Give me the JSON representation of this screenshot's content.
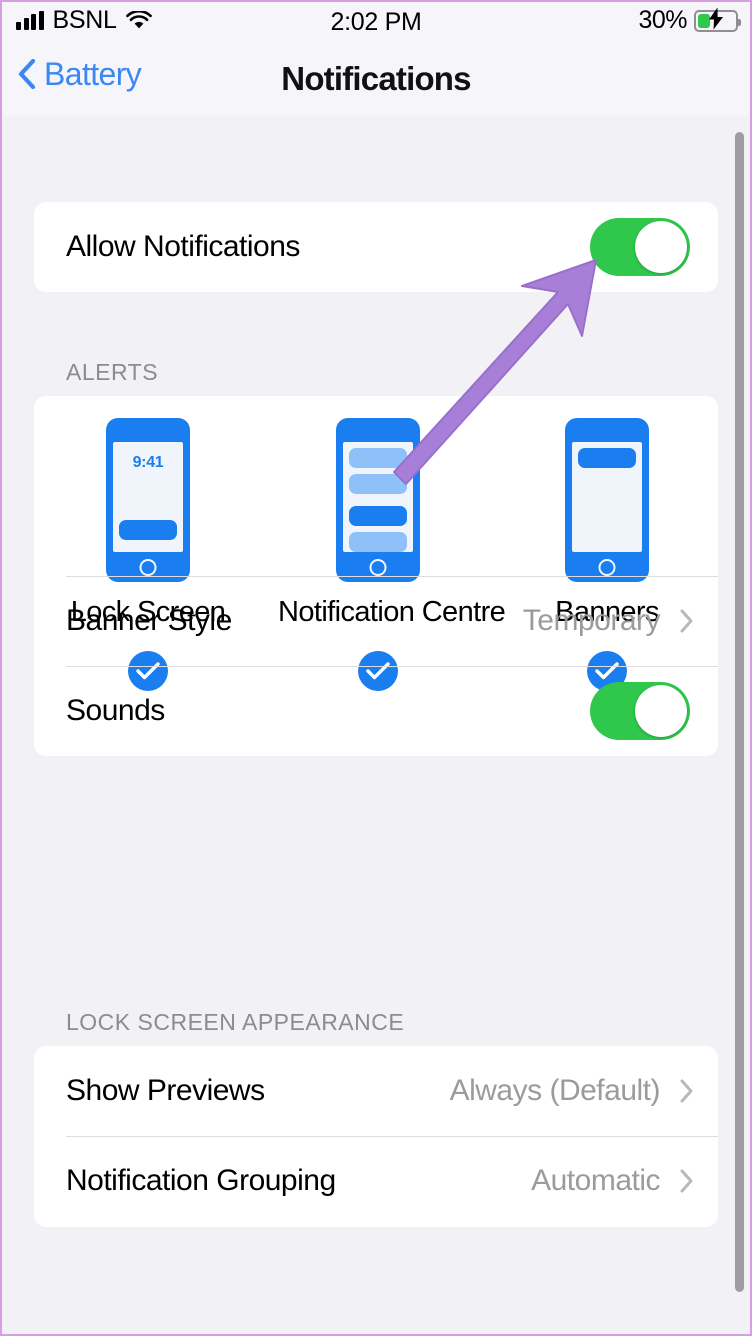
{
  "status_bar": {
    "carrier": "BSNL",
    "time": "2:02 PM",
    "battery_percent": "30%",
    "battery_level": 30,
    "charging": true,
    "signal_bars": 4,
    "wifi": true
  },
  "nav": {
    "back_label": "Battery",
    "title": "Notifications",
    "accent_color": "#3b87f5"
  },
  "main": {
    "allow": {
      "label": "Allow Notifications",
      "toggle_on": true
    },
    "alerts": {
      "header": "ALERTS",
      "options": [
        {
          "label": "Lock Screen",
          "selected": true,
          "clock": "9:41"
        },
        {
          "label": "Notification Centre",
          "selected": true
        },
        {
          "label": "Banners",
          "selected": true
        }
      ],
      "banner_style": {
        "label": "Banner Style",
        "value": "Temporary"
      },
      "sounds": {
        "label": "Sounds",
        "toggle_on": true
      }
    },
    "lock_screen_appearance": {
      "header": "LOCK SCREEN APPEARANCE",
      "rows": [
        {
          "label": "Show Previews",
          "value": "Always (Default)"
        },
        {
          "label": "Notification Grouping",
          "value": "Automatic"
        }
      ]
    }
  },
  "annotation": {
    "arrow_color": "#a87fd8",
    "points_at": "Allow Notifications toggle"
  },
  "colors": {
    "toggle_on": "#2fc84c",
    "tint_blue": "#1a7ef0",
    "link_blue": "#3b87f5",
    "page_background": "#f2f1f6",
    "card_background": "#ffffff",
    "secondary_text": "#9b9b9f"
  }
}
